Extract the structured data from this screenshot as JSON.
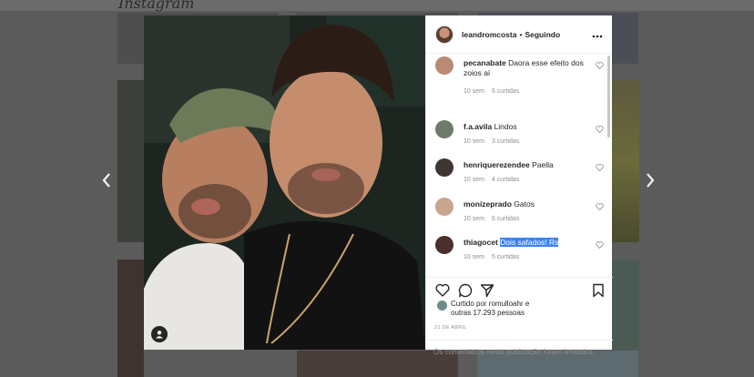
{
  "background": {
    "brand": "Instagram"
  },
  "post": {
    "author": "leandromcosta",
    "separator": "•",
    "follow_status": "Seguindo",
    "more_icon": "ellipsis-icon"
  },
  "comments": [
    {
      "user": "pecanabate",
      "text": "Daora esse efeito dos zoios aí",
      "time": "10 sem",
      "likes": "6 curtidas",
      "avatar_color": "#b98b72"
    },
    {
      "user": "f.a.avila",
      "text": "Lindos",
      "time": "10 sem",
      "likes": "3 curtidas",
      "avatar_color": "#6f7b6a"
    },
    {
      "user": "henriquerezendee",
      "text": "Paella",
      "time": "10 sem",
      "likes": "4 curtidas",
      "avatar_color": "#3d3632"
    },
    {
      "user": "monizeprado",
      "text": "Gatos",
      "time": "10 sem",
      "likes": "6 curtidas",
      "avatar_color": "#c9a58e"
    },
    {
      "user": "thiagocet",
      "text": "Dois safados! Rs",
      "time": "10 sem",
      "likes": "5 curtidas",
      "avatar_color": "#4a2f2c"
    }
  ],
  "likes": {
    "line1": "Curtido por romulloahr e",
    "line2": "outras 17.293 pessoas"
  },
  "date": "21 DE ABRIL",
  "comments_limited": "Os comentários nesta publicação foram limitados.",
  "colors": {
    "highlight": "#3b82f6",
    "text": "#262626",
    "muted": "#8e8e8e"
  }
}
